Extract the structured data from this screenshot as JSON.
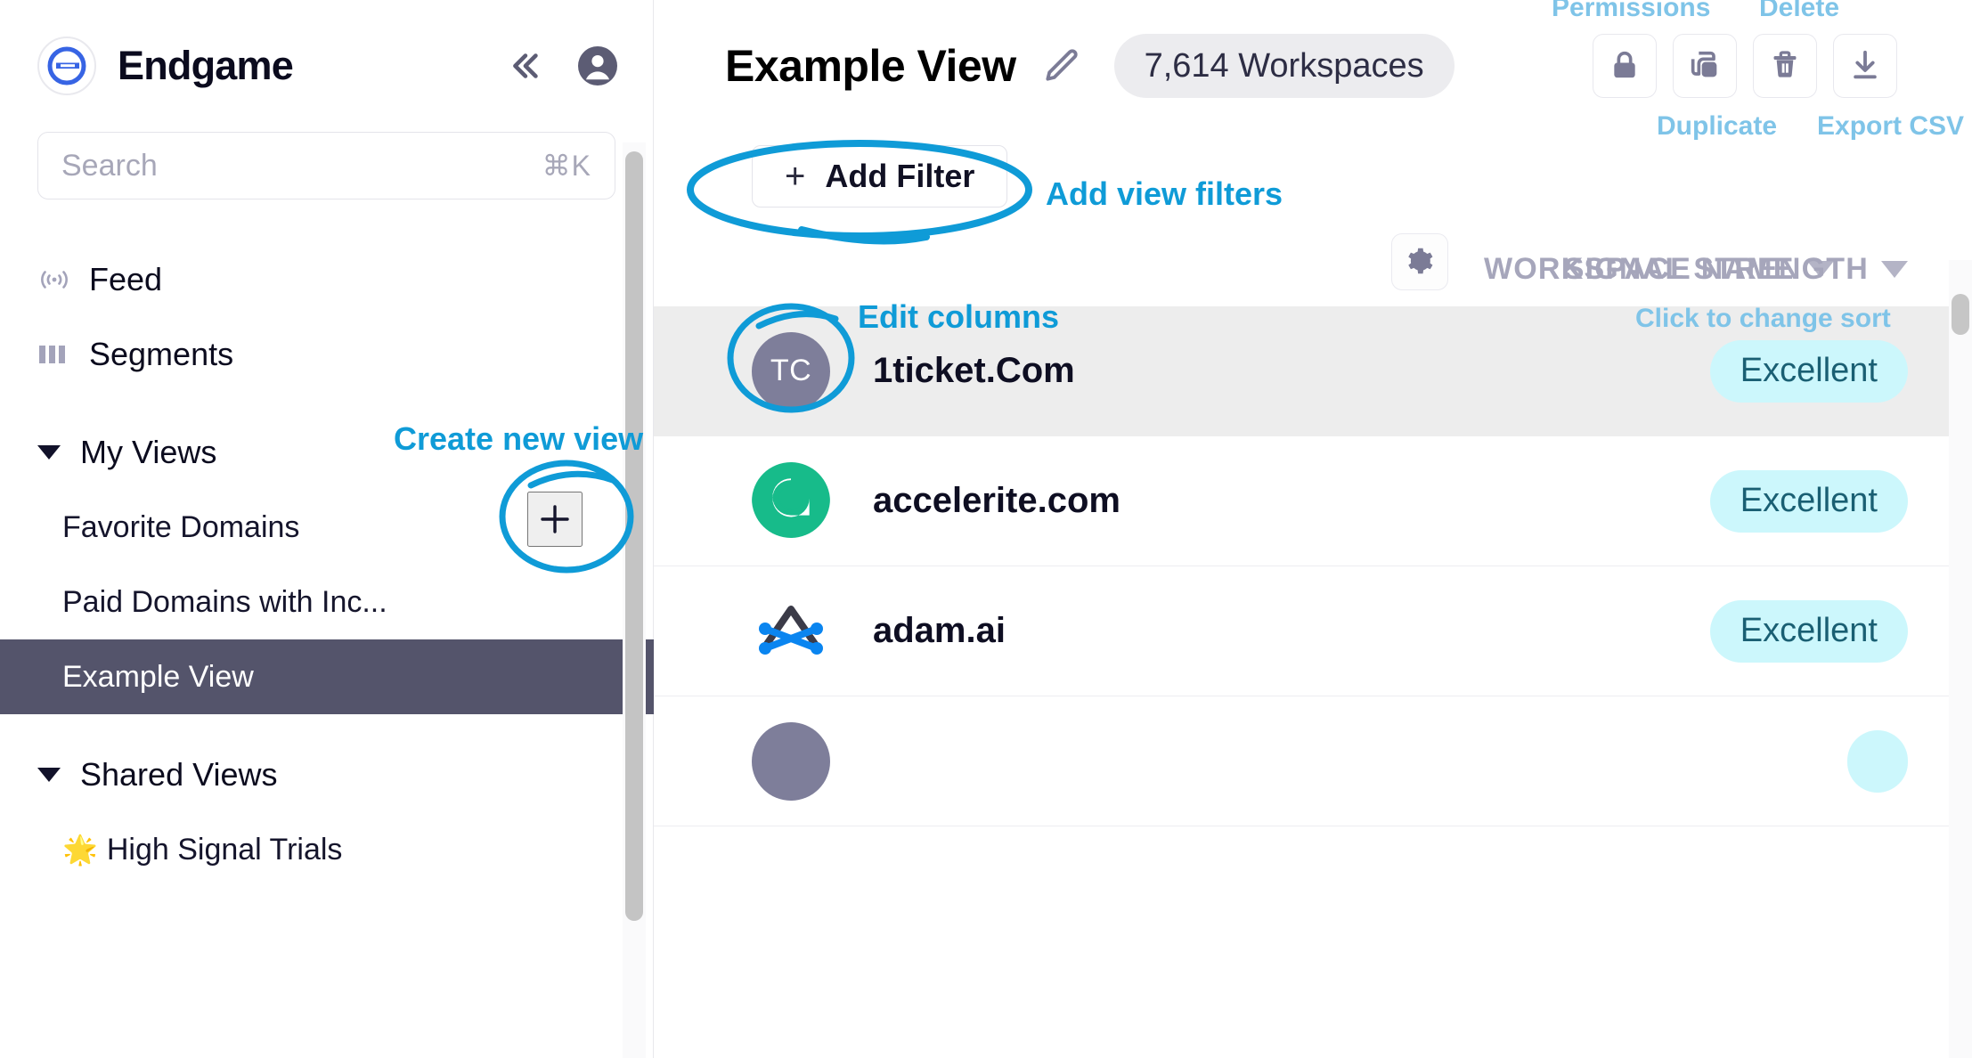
{
  "brand": {
    "name": "Endgame",
    "logo_icon": "endgame-logo-icon",
    "collapse_icon": "collapse-sidebar-icon",
    "profile_icon": "user-profile-icon"
  },
  "search": {
    "placeholder": "Search",
    "shortcut": "⌘K",
    "icon": "search-icon"
  },
  "sidebar": {
    "nav": [
      {
        "label": "Feed",
        "icon": "feed-broadcast-icon"
      },
      {
        "label": "Segments",
        "icon": "segments-bars-icon"
      }
    ],
    "groups": [
      {
        "label": "My Views",
        "expanded": true,
        "caret_icon": "chevron-down-icon",
        "items": [
          {
            "label": "Favorite Domains",
            "emoji": "",
            "selected": false
          },
          {
            "label": "Paid Domains with Inc...",
            "emoji": "",
            "selected": false
          },
          {
            "label": "Example View",
            "emoji": "",
            "selected": true
          }
        ]
      },
      {
        "label": "Shared Views",
        "expanded": true,
        "caret_icon": "chevron-down-icon",
        "items": [
          {
            "label": "High Signal Trials",
            "emoji": "🌟",
            "selected": false
          }
        ]
      }
    ],
    "create_view_button": {
      "icon": "plus-icon",
      "label": "+"
    }
  },
  "header": {
    "title": "Example View",
    "edit_icon": "pencil-edit-icon",
    "count_pill": "7,614 Workspaces",
    "actions": [
      {
        "name": "permissions-button",
        "icon": "lock-icon"
      },
      {
        "name": "duplicate-button",
        "icon": "copy-icon"
      },
      {
        "name": "delete-button",
        "icon": "trash-icon"
      },
      {
        "name": "export-csv-button",
        "icon": "download-icon"
      }
    ]
  },
  "filters": {
    "add_filter_label": "Add Filter",
    "add_filter_plus": "+"
  },
  "table": {
    "settings_icon": "gear-icon",
    "columns": [
      {
        "label": "WORKSPACE NAME",
        "sort_icon": "triangle-down-icon"
      },
      {
        "label": "SIGNAL STRENGTH",
        "sort_icon": "triangle-down-icon"
      }
    ],
    "rows": [
      {
        "name": "1ticket.Com",
        "signal": "Excellent",
        "avatar_type": "initials",
        "initials": "TC",
        "avatar_color": "#7e7e9a",
        "highlighted": true
      },
      {
        "name": "accelerite.com",
        "signal": "Excellent",
        "avatar_type": "logo-accelerite",
        "initials": "",
        "avatar_color": "#17bb8a",
        "highlighted": false
      },
      {
        "name": "adam.ai",
        "signal": "Excellent",
        "avatar_type": "logo-adam",
        "initials": "",
        "avatar_color": "#ffffff",
        "highlighted": false
      },
      {
        "name": "",
        "signal": "",
        "avatar_type": "initials",
        "initials": "",
        "avatar_color": "#7e7e9a",
        "highlighted": false
      }
    ]
  },
  "annotations": {
    "create_new_view": "Create new view",
    "add_view_filters": "Add view filters",
    "edit_columns": "Edit columns",
    "click_to_change_sort": "Click to change sort",
    "permissions": "Permissions",
    "duplicate": "Duplicate",
    "delete": "Delete",
    "export_csv": "Export CSV"
  },
  "colors": {
    "annotation_primary": "#0f9bd7",
    "annotation_secondary": "#7fc4e8",
    "brand_blue": "#3764e4",
    "selected_row_bg": "#54546b",
    "badge_bg": "#ccf7fc",
    "badge_text": "#1a5f73"
  }
}
